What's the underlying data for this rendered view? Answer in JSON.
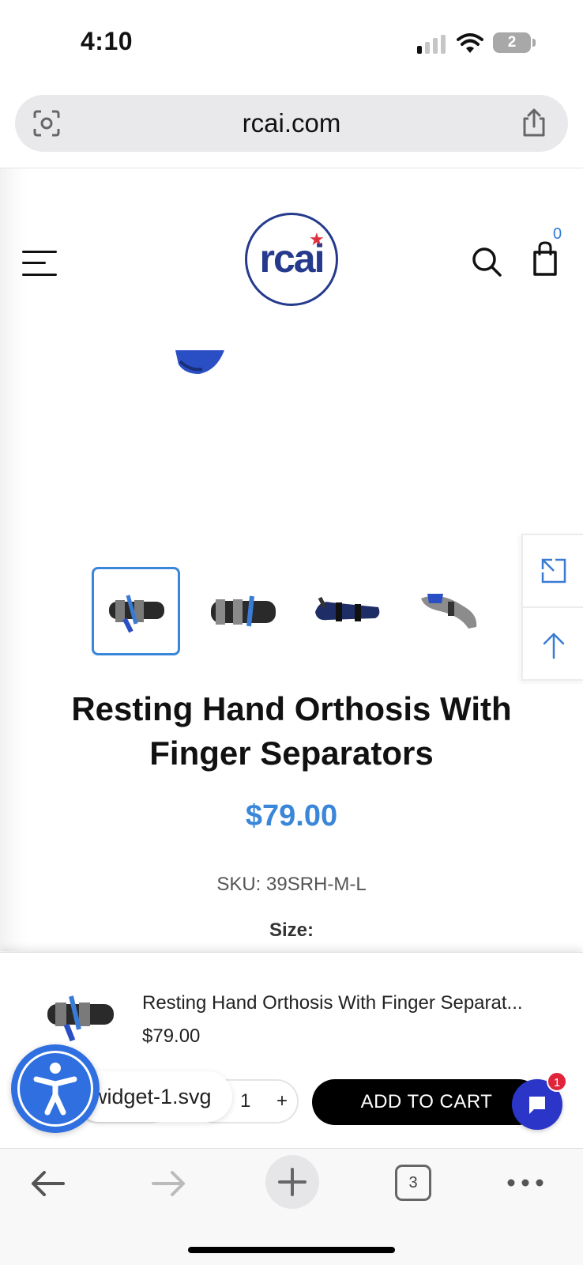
{
  "status_bar": {
    "time": "4:10",
    "battery_level": "2",
    "icons": [
      "signal-icon",
      "wifi-icon",
      "battery-icon"
    ]
  },
  "browser": {
    "url": "rcai.com",
    "left_icon": "camera-scan-icon",
    "right_icon": "share-icon"
  },
  "header": {
    "logo_text": "rcai",
    "cart_count": "0",
    "icons": [
      "hamburger-menu-icon",
      "search-icon",
      "shopping-bag-icon"
    ],
    "brand_color": "#253a8c",
    "logo_star_color": "#e03040"
  },
  "product": {
    "title": "Resting Hand Orthosis With Finger Separators",
    "price": "$79.00",
    "sku": "SKU: 39SRH-M-L",
    "size_label": "Size:",
    "accent_color": "#3a86d8",
    "thumbnails": [
      {
        "name": "thumbnail-1",
        "selected": true
      },
      {
        "name": "thumbnail-2",
        "selected": false
      },
      {
        "name": "thumbnail-3",
        "selected": false
      },
      {
        "name": "thumbnail-4",
        "selected": false
      }
    ]
  },
  "side_tools": {
    "icons": [
      "expand-icon",
      "arrow-up-icon"
    ]
  },
  "sticky_cart": {
    "name": "Resting Hand Orthosis With Finger Separat...",
    "price": "$79.00",
    "quantity": "1",
    "plus": "+",
    "add_to_cart": "ADD TO CART",
    "widget_tooltip": "widget-1.svg",
    "chat_badge": "1",
    "icons": [
      "accessibility-icon",
      "chat-icon"
    ]
  },
  "toolbar": {
    "tabs_count": "3",
    "icons": [
      "back-arrow-icon",
      "forward-arrow-icon",
      "plus-icon",
      "tabs-icon",
      "more-icon"
    ]
  }
}
